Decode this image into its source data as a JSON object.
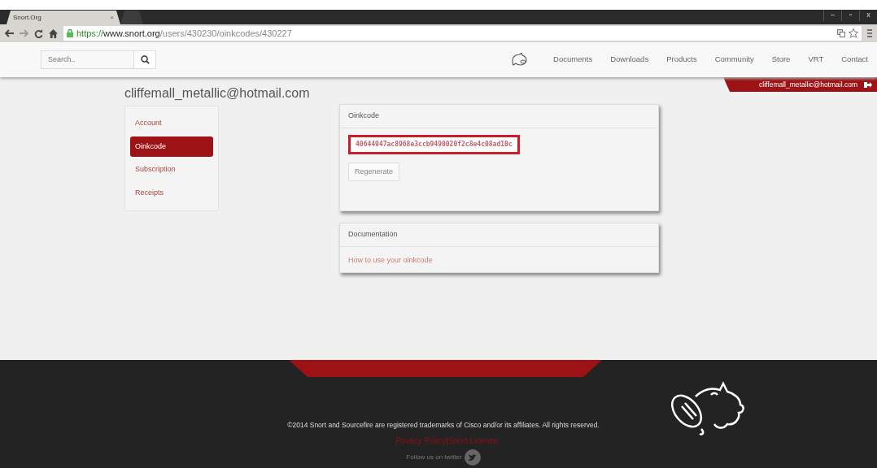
{
  "browser": {
    "tabs": [
      {
        "label": "Snort.Org",
        "selected": true,
        "close": "×"
      },
      {
        "selected": false
      }
    ],
    "url": {
      "scheme": "https://",
      "host": "www.snort.org",
      "path": "/users/430230/oinkcodes/430227"
    },
    "window_controls": [
      "–",
      "▫",
      "x"
    ]
  },
  "navbar": {
    "search": {
      "placeholder": "Search.."
    },
    "links": [
      "Documents",
      "Downloads",
      "Products",
      "Community",
      "Store",
      "VRT",
      "Contact"
    ],
    "user": "cliffemall_metallic@hotmail.com"
  },
  "page_title": "cliffemall_metallic@hotmail.com",
  "sidebar": {
    "items": [
      {
        "label": "Account",
        "selected": false
      },
      {
        "label": "Oinkcode",
        "selected": true
      },
      {
        "label": "Subscription",
        "selected": false
      },
      {
        "label": "Receipts",
        "selected": false
      }
    ]
  },
  "oinkcode_panel": {
    "title": "Oinkcode",
    "code": "40644947ac8968e3ccb9490020f2c8e4c08ad10c",
    "button": "Regenerate"
  },
  "documentation_panel": {
    "title": "Documentation",
    "link": "How to use your oinkcode"
  },
  "footer": {
    "copyright": "©2014 Snort and Sourcefire are registered trademarks of Cisco and/or its affiliates. All rights reserved.",
    "links": [
      "Privacy Policy",
      "Snort License"
    ],
    "separator": "|",
    "follow": "Follow us on twitter"
  }
}
